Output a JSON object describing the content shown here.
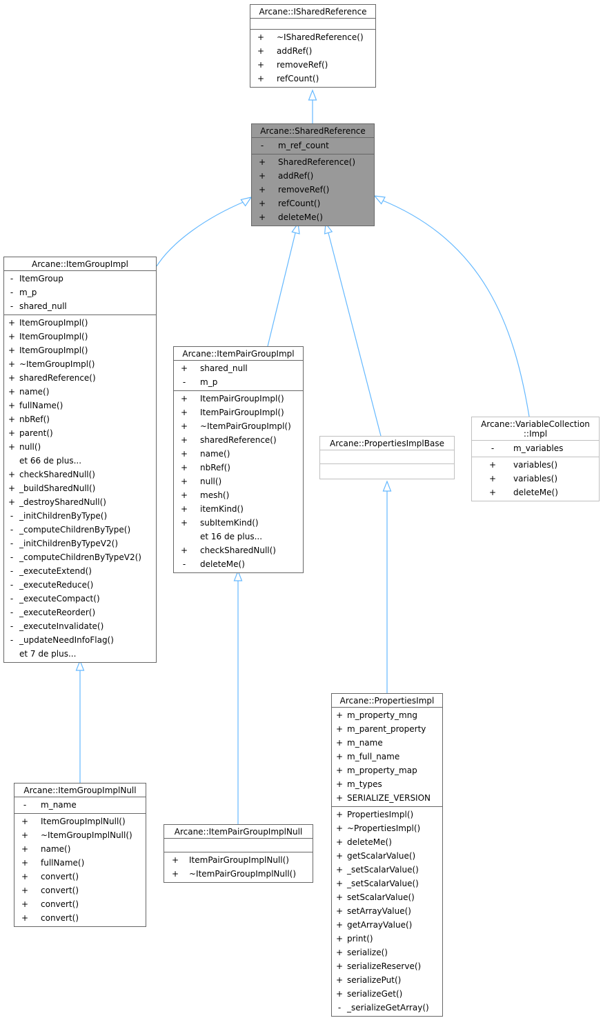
{
  "diagram": {
    "type": "class-inheritance",
    "colors": {
      "edge": "#63b8ff",
      "box_border": "#666666",
      "focus_fill": "#999999",
      "light_border": "#bfbfbf"
    },
    "classes": {
      "ishared": {
        "title": "Arcane::ISharedReference",
        "attributes": [],
        "methods": [
          {
            "vis": "+",
            "name": "~ISharedReference()"
          },
          {
            "vis": "+",
            "name": "addRef()"
          },
          {
            "vis": "+",
            "name": "removeRef()"
          },
          {
            "vis": "+",
            "name": "refCount()"
          }
        ]
      },
      "shared": {
        "title": "Arcane::SharedReference",
        "attributes": [
          {
            "vis": "-",
            "name": "m_ref_count"
          }
        ],
        "methods": [
          {
            "vis": "+",
            "name": "SharedReference()"
          },
          {
            "vis": "+",
            "name": "addRef()"
          },
          {
            "vis": "+",
            "name": "removeRef()"
          },
          {
            "vis": "+",
            "name": "refCount()"
          },
          {
            "vis": "+",
            "name": "deleteMe()"
          }
        ]
      },
      "itemgroup": {
        "title": "Arcane::ItemGroupImpl",
        "attributes": [
          {
            "vis": "-",
            "name": "ItemGroup"
          },
          {
            "vis": "-",
            "name": "m_p"
          },
          {
            "vis": "-",
            "name": "shared_null"
          }
        ],
        "methods": [
          {
            "vis": "+",
            "name": "ItemGroupImpl()"
          },
          {
            "vis": "+",
            "name": "ItemGroupImpl()"
          },
          {
            "vis": "+",
            "name": "ItemGroupImpl()"
          },
          {
            "vis": "+",
            "name": "~ItemGroupImpl()"
          },
          {
            "vis": "+",
            "name": "sharedReference()"
          },
          {
            "vis": "+",
            "name": "name()"
          },
          {
            "vis": "+",
            "name": "fullName()"
          },
          {
            "vis": "+",
            "name": "nbRef()"
          },
          {
            "vis": "+",
            "name": "parent()"
          },
          {
            "vis": "+",
            "name": "null()"
          },
          {
            "vis": "",
            "name": "et 66 de plus..."
          },
          {
            "vis": "+",
            "name": "checkSharedNull()"
          },
          {
            "vis": "+",
            "name": "_buildSharedNull()"
          },
          {
            "vis": "+",
            "name": "_destroySharedNull()"
          },
          {
            "vis": "-",
            "name": "_initChildrenByType()"
          },
          {
            "vis": "-",
            "name": "_computeChildrenByType()"
          },
          {
            "vis": "-",
            "name": "_initChildrenByTypeV2()"
          },
          {
            "vis": "-",
            "name": "_computeChildrenByTypeV2()"
          },
          {
            "vis": "-",
            "name": "_executeExtend()"
          },
          {
            "vis": "-",
            "name": "_executeReduce()"
          },
          {
            "vis": "-",
            "name": "_executeCompact()"
          },
          {
            "vis": "-",
            "name": "_executeReorder()"
          },
          {
            "vis": "-",
            "name": "_executeInvalidate()"
          },
          {
            "vis": "-",
            "name": "_updateNeedInfoFlag()"
          },
          {
            "vis": "",
            "name": "et 7 de plus..."
          }
        ]
      },
      "itempair": {
        "title": "Arcane::ItemPairGroupImpl",
        "attributes": [
          {
            "vis": "+",
            "name": "shared_null"
          },
          {
            "vis": "-",
            "name": "m_p"
          }
        ],
        "methods": [
          {
            "vis": "+",
            "name": "ItemPairGroupImpl()"
          },
          {
            "vis": "+",
            "name": "ItemPairGroupImpl()"
          },
          {
            "vis": "+",
            "name": "~ItemPairGroupImpl()"
          },
          {
            "vis": "+",
            "name": "sharedReference()"
          },
          {
            "vis": "+",
            "name": "name()"
          },
          {
            "vis": "+",
            "name": "nbRef()"
          },
          {
            "vis": "+",
            "name": "null()"
          },
          {
            "vis": "+",
            "name": "mesh()"
          },
          {
            "vis": "+",
            "name": "itemKind()"
          },
          {
            "vis": "+",
            "name": "subItemKind()"
          },
          {
            "vis": "",
            "name": "et 16 de plus..."
          },
          {
            "vis": "+",
            "name": "checkSharedNull()"
          },
          {
            "vis": "-",
            "name": "deleteMe()"
          }
        ]
      },
      "propbase": {
        "title": "Arcane::PropertiesImplBase",
        "attributes": [],
        "methods": []
      },
      "varcoll": {
        "title": "Arcane::VariableCollection\n::Impl",
        "title_line1": "Arcane::VariableCollection",
        "title_line2": "::Impl",
        "attributes": [
          {
            "vis": "-",
            "name": "m_variables"
          }
        ],
        "methods": [
          {
            "vis": "+",
            "name": "variables()"
          },
          {
            "vis": "+",
            "name": "variables()"
          },
          {
            "vis": "+",
            "name": "deleteMe()"
          }
        ]
      },
      "groupnull": {
        "title": "Arcane::ItemGroupImplNull",
        "attributes": [
          {
            "vis": "-",
            "name": "m_name"
          }
        ],
        "methods": [
          {
            "vis": "+",
            "name": "ItemGroupImplNull()"
          },
          {
            "vis": "+",
            "name": "~ItemGroupImplNull()"
          },
          {
            "vis": "+",
            "name": "name()"
          },
          {
            "vis": "+",
            "name": "fullName()"
          },
          {
            "vis": "+",
            "name": "convert()"
          },
          {
            "vis": "+",
            "name": "convert()"
          },
          {
            "vis": "+",
            "name": "convert()"
          },
          {
            "vis": "+",
            "name": "convert()"
          }
        ]
      },
      "pairnull": {
        "title": "Arcane::ItemPairGroupImplNull",
        "attributes": [],
        "methods": [
          {
            "vis": "+",
            "name": "ItemPairGroupImplNull()"
          },
          {
            "vis": "+",
            "name": "~ItemPairGroupImplNull()"
          }
        ]
      },
      "propimpl": {
        "title": "Arcane::PropertiesImpl",
        "attributes": [
          {
            "vis": "+",
            "name": "m_property_mng"
          },
          {
            "vis": "+",
            "name": "m_parent_property"
          },
          {
            "vis": "+",
            "name": "m_name"
          },
          {
            "vis": "+",
            "name": "m_full_name"
          },
          {
            "vis": "+",
            "name": "m_property_map"
          },
          {
            "vis": "+",
            "name": "m_types"
          },
          {
            "vis": "+",
            "name": "SERIALIZE_VERSION"
          }
        ],
        "methods": [
          {
            "vis": "+",
            "name": "PropertiesImpl()"
          },
          {
            "vis": "+",
            "name": "~PropertiesImpl()"
          },
          {
            "vis": "+",
            "name": "deleteMe()"
          },
          {
            "vis": "+",
            "name": "getScalarValue()"
          },
          {
            "vis": "+",
            "name": "_setScalarValue()"
          },
          {
            "vis": "+",
            "name": "_setScalarValue()"
          },
          {
            "vis": "+",
            "name": "setScalarValue()"
          },
          {
            "vis": "+",
            "name": "setArrayValue()"
          },
          {
            "vis": "+",
            "name": "getArrayValue()"
          },
          {
            "vis": "+",
            "name": "print()"
          },
          {
            "vis": "+",
            "name": "serialize()"
          },
          {
            "vis": "+",
            "name": "serializeReserve()"
          },
          {
            "vis": "+",
            "name": "serializePut()"
          },
          {
            "vis": "+",
            "name": "serializeGet()"
          },
          {
            "vis": "-",
            "name": "_serializeGetArray()"
          }
        ]
      }
    },
    "edges": [
      {
        "from": "shared",
        "to": "ishared",
        "kind": "inheritance"
      },
      {
        "from": "itemgroup",
        "to": "shared",
        "kind": "inheritance"
      },
      {
        "from": "itempair",
        "to": "shared",
        "kind": "inheritance"
      },
      {
        "from": "propbase",
        "to": "shared",
        "kind": "inheritance"
      },
      {
        "from": "varcoll",
        "to": "shared",
        "kind": "inheritance"
      },
      {
        "from": "groupnull",
        "to": "itemgroup",
        "kind": "inheritance"
      },
      {
        "from": "pairnull",
        "to": "itempair",
        "kind": "inheritance"
      },
      {
        "from": "propimpl",
        "to": "propbase",
        "kind": "inheritance"
      }
    ]
  }
}
